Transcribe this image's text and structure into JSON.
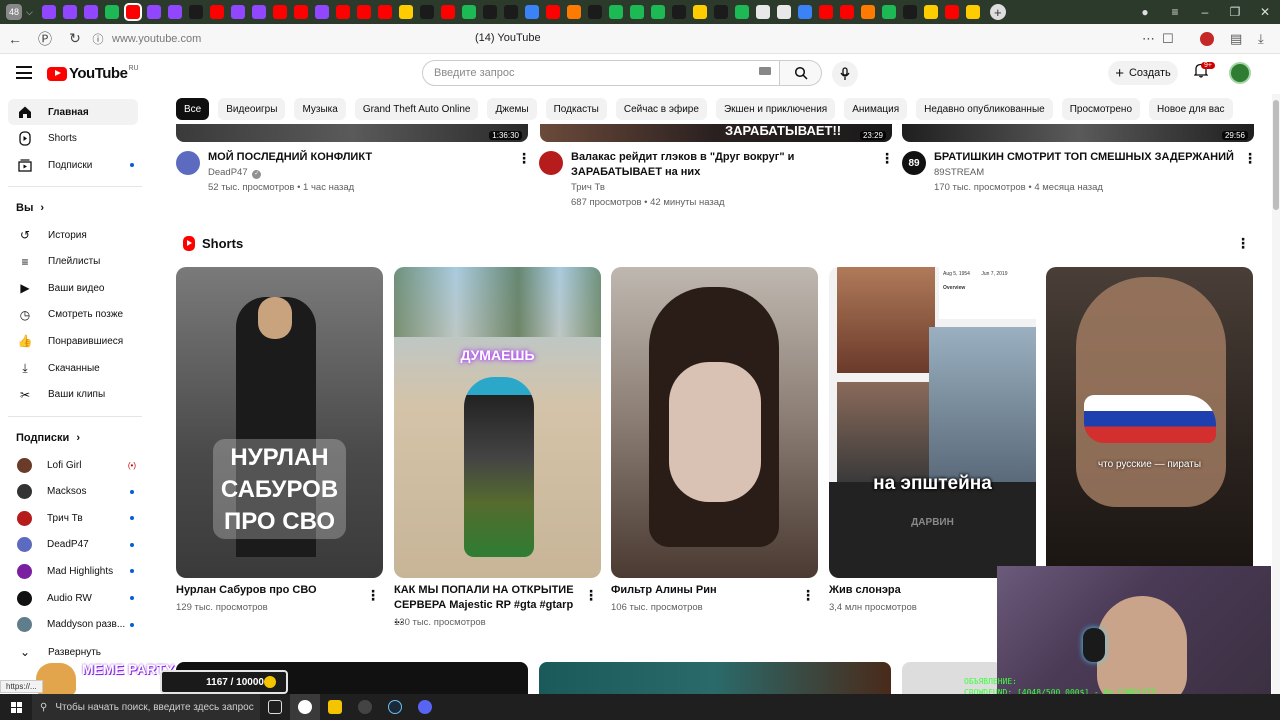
{
  "browser": {
    "tab_count": "48",
    "url": "www.youtube.com",
    "page_title": "(14) YouTube",
    "tab_icon_colors": [
      "purple",
      "purple",
      "purple",
      "green",
      "red",
      "purple",
      "purple",
      "dark",
      "red",
      "purple",
      "purple",
      "red",
      "red",
      "purple",
      "red",
      "red",
      "red",
      "yellow",
      "dark",
      "red",
      "green",
      "dark",
      "dark",
      "blue",
      "red",
      "orange",
      "dark",
      "green",
      "green",
      "green",
      "dark",
      "yellow",
      "dark",
      "green",
      "white",
      "white",
      "blue",
      "red",
      "red",
      "orange",
      "green",
      "dark",
      "yellow",
      "red",
      "yellow"
    ]
  },
  "header": {
    "logo_text": "YouTube",
    "logo_region": "RU",
    "search_placeholder": "Введите запрос",
    "create_label": "Создать",
    "notif_badge": "9+"
  },
  "sidebar": {
    "main": [
      {
        "label": "Главная",
        "icon": "home-icon"
      },
      {
        "label": "Shorts",
        "icon": "shorts-icon"
      },
      {
        "label": "Подписки",
        "icon": "subscriptions-icon"
      }
    ],
    "you_heading": "Вы",
    "you_items": [
      {
        "label": "История",
        "icon": "history-icon"
      },
      {
        "label": "Плейлисты",
        "icon": "playlists-icon"
      },
      {
        "label": "Ваши видео",
        "icon": "your-videos-icon"
      },
      {
        "label": "Смотреть позже",
        "icon": "watch-later-icon"
      },
      {
        "label": "Понравившиеся",
        "icon": "liked-icon"
      },
      {
        "label": "Скачанные",
        "icon": "downloads-icon"
      },
      {
        "label": "Ваши клипы",
        "icon": "clips-icon"
      }
    ],
    "subs_heading": "Подписки",
    "subs": [
      {
        "label": "Lofi Girl",
        "color": "#6b3b2a",
        "live": true
      },
      {
        "label": "Macksos",
        "color": "#333333"
      },
      {
        "label": "Трич Тв",
        "color": "#b71c1c"
      },
      {
        "label": "DeadP47",
        "color": "#5c6bc0"
      },
      {
        "label": "Mad Highlights",
        "color": "#7b1fa2"
      },
      {
        "label": "Audio RW",
        "color": "#111111"
      },
      {
        "label": "Maddyson разв...",
        "color": "#607d8b"
      }
    ],
    "expand_label": "Развернуть"
  },
  "chips": [
    "Все",
    "Видеоигры",
    "Музыка",
    "Grand Theft Auto Online",
    "Джемы",
    "Подкасты",
    "Сейчас в эфире",
    "Экшен и приключения",
    "Анимация",
    "Недавно опубликованные",
    "Просмотрено",
    "Новое для вас"
  ],
  "videos": [
    {
      "title": "МОЙ ПОСЛЕДНИЙ КОНФЛИКТ",
      "channel": "DeadP47",
      "verified": true,
      "stats": "52 тыс. просмотров • 1 час назад",
      "duration": "1:36:30",
      "avatar_color": "#5c6bc0"
    },
    {
      "title": "Валакас рейдит глэков в \"Друг вокруг\" и ЗАРАБАТЫВАЕТ на них",
      "channel": "Трич Тв",
      "stats": "687 просмотров • 42 минуты назад",
      "duration": "23:29",
      "thumb_text": "ЗАРАБАТЫВАЕТ!!",
      "avatar_color": "#b71c1c"
    },
    {
      "title": "БРАТИШКИН СМОТРИТ ТОП СМЕШНЫХ ЗАДЕРЖАНИЙ",
      "channel": "89STREAM",
      "stats": "170 тыс. просмотров • 4 месяца назад",
      "duration": "29:56",
      "avatar_text": "89",
      "avatar_color": "#111111"
    }
  ],
  "shorts_heading": "Shorts",
  "shorts": [
    {
      "title": "Нурлан Сабуров про СВО",
      "views": "129 тыс. просмотров",
      "overlay": "НУРЛАН САБУРОВ ПРО СВО"
    },
    {
      "title": "КАК МЫ ПОПАЛИ НА ОТКРЫТИЕ СЕРВЕРА Majestic RP  #gta #gtarp ...",
      "views": "130 тыс. просмотров",
      "overlay": "ДУМАЕШЬ"
    },
    {
      "title": "Фильтр Алины Рин",
      "views": "106 тыс. просмотров"
    },
    {
      "title": "Жив слонэра",
      "views": "3,4 млн просмотров",
      "overlay": "на эпштейна",
      "doc_date_1": "Aug 5, 1954",
      "doc_date_2": "Jun 7, 2019",
      "doc_heading": "Overview",
      "sign": "ДАРВИН"
    },
    {
      "title": "",
      "views": "",
      "overlay": "что русские — пираты"
    }
  ],
  "overlays": {
    "meme_party": "MEME PARTY",
    "meme_counter": "1167 / 10000",
    "crowdfund_line1": "ОБЪЯВЛЕНИЕ:",
    "crowdfund_line2": "CROWDFUND: [4048/500 000$] - 0% COMPLETE",
    "status_url": "https://..."
  },
  "taskbar": {
    "search_placeholder": "Чтобы начать поиск, введите здесь запрос"
  }
}
